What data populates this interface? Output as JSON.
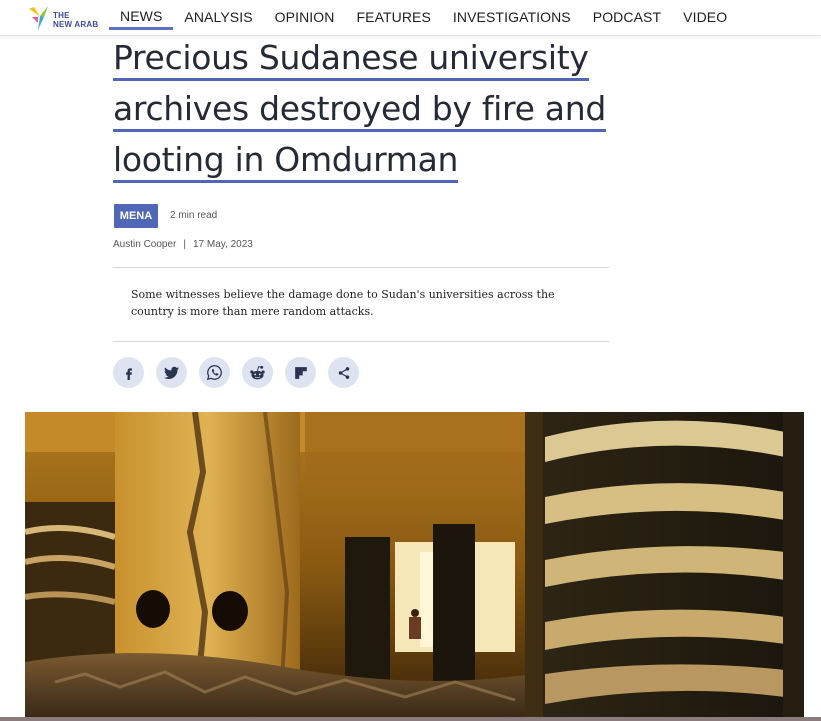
{
  "brand": {
    "logo_text_line1": "THE",
    "logo_text_line2": "NEW ARAB"
  },
  "nav": {
    "items": [
      {
        "label": "NEWS",
        "active": true
      },
      {
        "label": "ANALYSIS",
        "active": false
      },
      {
        "label": "OPINION",
        "active": false
      },
      {
        "label": "FEATURES",
        "active": false
      },
      {
        "label": "INVESTIGATIONS",
        "active": false
      },
      {
        "label": "PODCAST",
        "active": false
      },
      {
        "label": "VIDEO",
        "active": false
      }
    ]
  },
  "article": {
    "headline_lines": [
      "Precious Sudanese university",
      "archives destroyed by fire and",
      "looting in Omdurman"
    ],
    "tag": "MENA",
    "read_time": "2 min read",
    "author": "Austin Cooper",
    "separator": "|",
    "date": "17 May, 2023",
    "summary": "Some witnesses believe the damage done to Sudan's universities across the country is more than mere random attacks."
  },
  "share": {
    "buttons": [
      {
        "name": "facebook-icon"
      },
      {
        "name": "twitter-icon"
      },
      {
        "name": "whatsapp-icon"
      },
      {
        "name": "reddit-icon"
      },
      {
        "name": "flipboard-icon"
      },
      {
        "name": "share-icon"
      }
    ]
  },
  "colors": {
    "accent": "#5067b5",
    "share_bg": "#dde3f1",
    "icon_color": "#2a3350",
    "headline": "#262a36"
  }
}
